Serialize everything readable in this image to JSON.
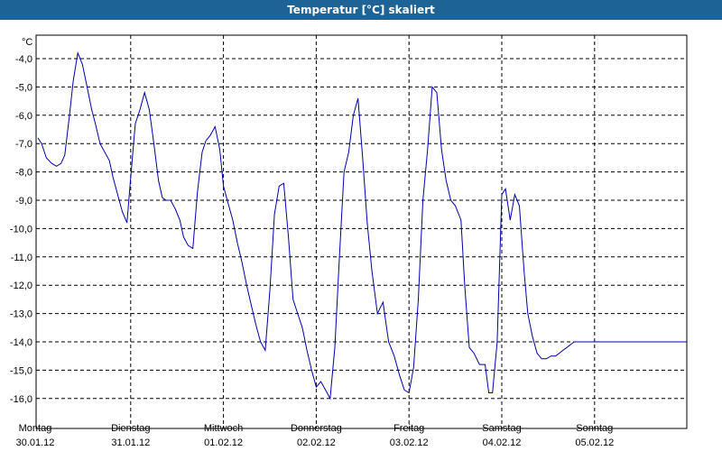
{
  "window": {
    "title": "Temperatur [°C] skaliert"
  },
  "chart_data": {
    "type": "line",
    "title": "Temperatur [°C] skaliert",
    "ylabel": "°C",
    "ylim": [
      -16.5,
      -3.5
    ],
    "yticks": [
      -4.0,
      -5.0,
      -6.0,
      -7.0,
      -8.0,
      -9.0,
      -10.0,
      -11.0,
      -12.0,
      -13.0,
      -14.0,
      -15.0,
      -16.0
    ],
    "ytick_labels": [
      "-4,0",
      "-5,0",
      "-6,0",
      "-7,0",
      "-8,0",
      "-9,0",
      "-10,0",
      "-11,0",
      "-12,0",
      "-13,0",
      "-14,0",
      "-15,0",
      "-16,0"
    ],
    "xlim": [
      0,
      7
    ],
    "x_unit": "days from Monday 30.01.12 00:00",
    "days": [
      {
        "day": "Montag",
        "date": "30.01.12"
      },
      {
        "day": "Dienstag",
        "date": "31.01.12"
      },
      {
        "day": "Mittwoch",
        "date": "01.02.12"
      },
      {
        "day": "Donnerstag",
        "date": "02.02.12"
      },
      {
        "day": "Freitag",
        "date": "03.02.12"
      },
      {
        "day": "Samstag",
        "date": "04.02.12"
      },
      {
        "day": "Sonntag",
        "date": "05.02.12"
      }
    ],
    "grid": true,
    "line_color": "#0000aa",
    "series": [
      {
        "x": [
          0.0,
          0.04,
          0.09,
          0.15,
          0.2,
          0.25,
          0.29,
          0.34,
          0.38,
          0.43,
          0.48,
          0.53,
          0.58,
          0.62,
          0.67,
          0.72,
          0.77,
          0.81,
          0.86,
          0.91,
          0.96,
          1.0,
          1.05,
          1.1,
          1.15,
          1.2,
          1.25,
          1.3,
          1.34,
          1.38,
          1.43,
          1.48,
          1.53,
          1.57,
          1.62,
          1.67,
          1.72,
          1.77,
          1.81,
          1.86,
          1.91,
          1.96,
          2.0,
          2.05,
          2.1,
          2.15,
          2.2,
          2.25,
          2.3,
          2.35,
          2.4,
          2.45,
          2.5,
          2.55,
          2.6,
          2.65,
          2.7,
          2.75,
          2.8,
          2.85,
          2.9,
          2.95,
          3.0,
          3.05,
          3.1,
          3.15,
          3.2,
          3.25,
          3.3,
          3.35,
          3.4,
          3.45,
          3.5,
          3.55,
          3.6,
          3.66,
          3.72,
          3.78,
          3.84,
          3.9,
          3.95,
          4.0,
          4.05,
          4.1,
          4.15,
          4.2,
          4.25,
          4.3,
          4.35,
          4.4,
          4.45,
          4.5,
          4.56,
          4.6,
          4.65,
          4.7,
          4.76,
          4.82,
          4.86,
          4.9,
          4.95,
          5.0,
          5.04,
          5.09,
          5.14,
          5.19,
          5.24,
          5.28,
          5.33,
          5.38,
          5.43,
          5.48,
          5.53,
          5.58,
          5.62,
          5.66,
          5.7,
          5.74,
          5.78,
          5.81,
          5.85,
          5.9,
          5.95,
          6.0,
          6.05,
          6.1,
          6.14,
          6.19,
          6.24,
          6.29,
          6.34,
          6.39,
          6.44,
          6.48,
          6.53,
          6.58,
          6.62,
          6.67,
          6.71,
          6.75,
          6.79,
          6.84,
          6.88,
          6.92,
          6.96,
          7.0
        ],
        "y": [
          -6.8,
          -7.0,
          -7.5,
          -7.7,
          -7.8,
          -7.7,
          -7.4,
          -6.0,
          -4.8,
          -3.8,
          -4.2,
          -5.0,
          -5.8,
          -6.3,
          -7.0,
          -7.3,
          -7.6,
          -8.2,
          -8.8,
          -9.4,
          -9.8,
          -8.2,
          -6.3,
          -5.8,
          -5.2,
          -5.8,
          -7.0,
          -8.3,
          -8.9,
          -9.0,
          -9.0,
          -9.3,
          -9.7,
          -10.3,
          -10.6,
          -10.7,
          -8.7,
          -7.3,
          -6.9,
          -6.7,
          -6.4,
          -7.2,
          -8.5,
          -9.1,
          -9.7,
          -10.5,
          -11.2,
          -12.0,
          -12.7,
          -13.4,
          -14.0,
          -14.3,
          -12.2,
          -9.5,
          -8.5,
          -8.4,
          -10.3,
          -12.5,
          -13.0,
          -13.5,
          -14.3,
          -15.0,
          -15.6,
          -15.4,
          -15.7,
          -16.0,
          -14.2,
          -11.0,
          -8.0,
          -7.3,
          -6.0,
          -5.4,
          -7.5,
          -9.8,
          -11.5,
          -13.0,
          -12.6,
          -14.0,
          -14.5,
          -15.2,
          -15.7,
          -15.8,
          -14.9,
          -12.5,
          -9.0,
          -7.2,
          -5.0,
          -5.2,
          -7.2,
          -8.3,
          -9.0,
          -9.2,
          -9.7,
          -12.0,
          -14.2,
          -14.4,
          -14.8,
          -14.8,
          -15.8,
          -15.8,
          -14.0,
          -8.8,
          -8.6,
          -9.7,
          -8.8,
          -9.2,
          -11.5,
          -13.0,
          -13.8,
          -14.4,
          -14.6,
          -14.6,
          -14.5,
          -14.5,
          -14.4,
          -14.3,
          -14.2,
          -14.1,
          -14.0,
          -14.0,
          -14.0,
          -14.0,
          -14.0,
          -14.0,
          -14.0,
          -14.0,
          -14.0,
          -14.0,
          -14.0,
          -14.0,
          -14.0,
          -14.0,
          -14.0,
          -14.0,
          -14.0,
          -14.0,
          -14.0,
          -14.0,
          -14.0,
          -14.0,
          -14.0,
          -14.0,
          -14.0,
          -14.0,
          -14.0,
          -14.0
        ]
      }
    ]
  }
}
